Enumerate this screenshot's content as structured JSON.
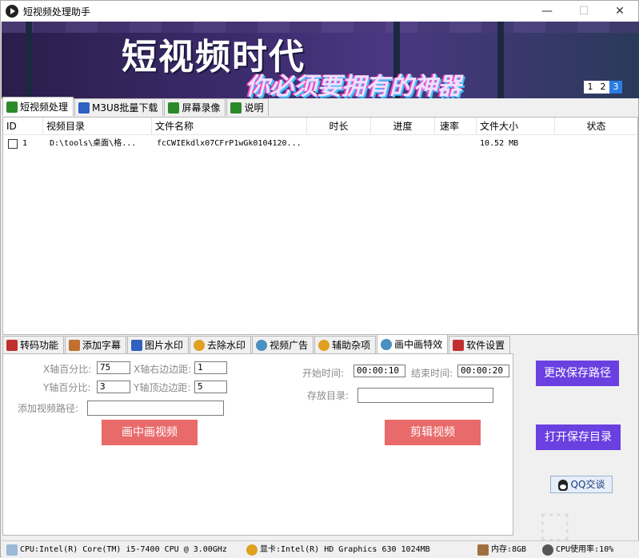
{
  "window": {
    "title": "短视频处理助手"
  },
  "banner": {
    "title": "短视频时代",
    "subtitle": "你必须要拥有的神器",
    "pager": [
      "1",
      "2",
      "3"
    ]
  },
  "top_tabs": [
    {
      "label": "短视频处理",
      "icon": "film-icon",
      "color": "#2a8a2a"
    },
    {
      "label": "M3U8批量下载",
      "icon": "grid-icon",
      "color": "#3060c0"
    },
    {
      "label": "屏幕录像",
      "icon": "screen-icon",
      "color": "#2a8a2a"
    },
    {
      "label": "说明",
      "icon": "info-icon",
      "color": "#2a8a2a"
    }
  ],
  "table": {
    "columns": [
      "ID",
      "视频目录",
      "文件名称",
      "时长",
      "进度",
      "速率",
      "文件大小",
      "状态"
    ],
    "rows": [
      {
        "id": "1",
        "dir": "D:\\tools\\桌面\\格...",
        "name": "fcCWIEkdlx07CFrP1wGk0104120...",
        "duration": "",
        "progress": "",
        "speed": "",
        "size": "10.52 MB",
        "status": ""
      }
    ]
  },
  "bottom_tabs": [
    {
      "label": "转码功能",
      "icon": "transcode-icon",
      "color": "#c03030"
    },
    {
      "label": "添加字幕",
      "icon": "subtitle-icon",
      "color": "#c07030"
    },
    {
      "label": "图片水印",
      "icon": "image-icon",
      "color": "#3060c0"
    },
    {
      "label": "去除水印",
      "icon": "sun-icon",
      "color": "#e0a020"
    },
    {
      "label": "视频广告",
      "icon": "cloud-icon",
      "color": "#4a90c0"
    },
    {
      "label": "辅助杂项",
      "icon": "gear-icon",
      "color": "#e0a020"
    },
    {
      "label": "画中画特效",
      "icon": "pip-icon",
      "color": "#4a90c0"
    },
    {
      "label": "软件设置",
      "icon": "tool-icon",
      "color": "#c03030"
    }
  ],
  "pip_panel": {
    "x_percent_label": "X轴百分比:",
    "x_percent_value": "75",
    "x_right_margin_label": "X轴右边边距:",
    "x_right_margin_value": "1",
    "y_percent_label": "Y轴百分比:",
    "y_percent_value": "3",
    "y_top_margin_label": "Y轴顶边边距:",
    "y_top_margin_value": "5",
    "add_video_path_label": "添加视频路径:",
    "add_video_path_value": "",
    "pip_button": "画中画视频",
    "start_time_label": "开始时间:",
    "start_time_value": "00:00:10",
    "end_time_label": "结束时间:",
    "end_time_value": "00:00:20",
    "save_dir_label": "存放目录:",
    "save_dir_value": "",
    "cut_button": "剪辑视频"
  },
  "side_buttons": {
    "change_save_path": "更改保存路径",
    "open_save_dir": "打开保存目录",
    "qq_chat": "QQ交谈"
  },
  "statusbar": {
    "cpu": "CPU:Intel(R) Core(TM) i5-7400 CPU @ 3.00GHz",
    "gpu": "显卡:Intel(R) HD Graphics 630   1024MB",
    "memory": "内存:8GB",
    "cpu_usage": "CPU使用率:10%"
  },
  "colors": {
    "accent_purple": "#6a40e0",
    "accent_red": "#e96a6a",
    "pager_active": "#2a7be4"
  }
}
